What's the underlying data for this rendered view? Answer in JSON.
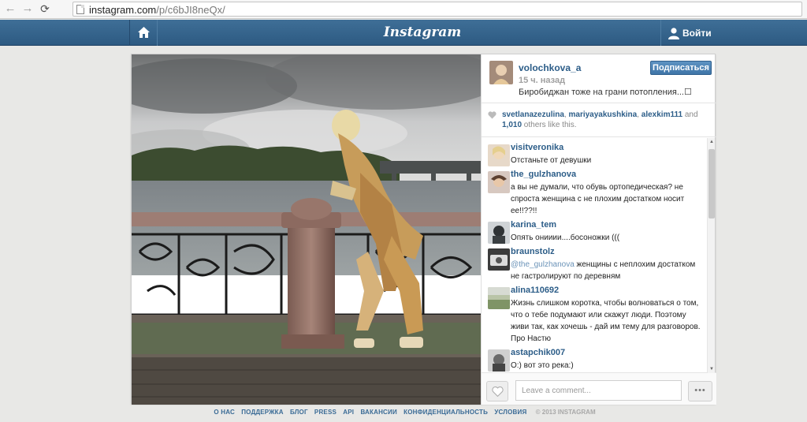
{
  "browser": {
    "url_host": "instagram.com",
    "url_path": "/p/c6bJI8neQx/",
    "back_icon": "arrow-left",
    "forward_icon": "arrow-right",
    "reload_icon": "reload"
  },
  "header": {
    "logo": "Instagram",
    "login_label": "Войти",
    "bar_color": "#356489"
  },
  "post": {
    "owner": {
      "username": "volochkova_a",
      "time_ago": "15 ч. назад",
      "caption": "Биробиджан тоже на грани потопления...☐",
      "follow_label": "Подписаться"
    },
    "likes": {
      "users": [
        "svetlanazezulina",
        "mariyayakushkina",
        "alexkim111"
      ],
      "sep1": ", ",
      "sep2": ", ",
      "and_text": " and",
      "count": "1,010",
      "suffix": " others like this."
    },
    "comments": [
      {
        "user": "visitveronika",
        "text": "Отстаньте от девушки"
      },
      {
        "user": "the_gulzhanova",
        "text": "а вы не думали, что обувь ортопедическая? не спроста женщина с не плохим достатком носит ее!!??!!"
      },
      {
        "user": "karina_tem",
        "text": "Опять онииии....босоножки ((("
      },
      {
        "user": "braunstolz",
        "mention": "@the_gulzhanova",
        "text": " женщины с неплохим достатком не гастролируют по деревням"
      },
      {
        "user": "alina110692",
        "text": "Жизнь слишком коротка, чтобы волноваться о том, что о тебе подумают или скажут люди. Поэтому живи так, как хочешь - дай им тему для разговоров. Про Настю"
      },
      {
        "user": "astapchik007",
        "text": "О:) вот это река:)"
      }
    ],
    "comment_placeholder": "Leave a comment...",
    "more_label": "•••",
    "accent_color": "#2c5d88"
  },
  "footer": {
    "links": [
      "О НАС",
      "ПОДДЕРЖКА",
      "БЛОГ",
      "PRESS",
      "API",
      "ВАКАНСИИ",
      "КОНФИДЕНЦИАЛЬНОСТЬ",
      "УСЛОВИЯ"
    ],
    "copyright": "© 2013 INSTAGRAM"
  }
}
